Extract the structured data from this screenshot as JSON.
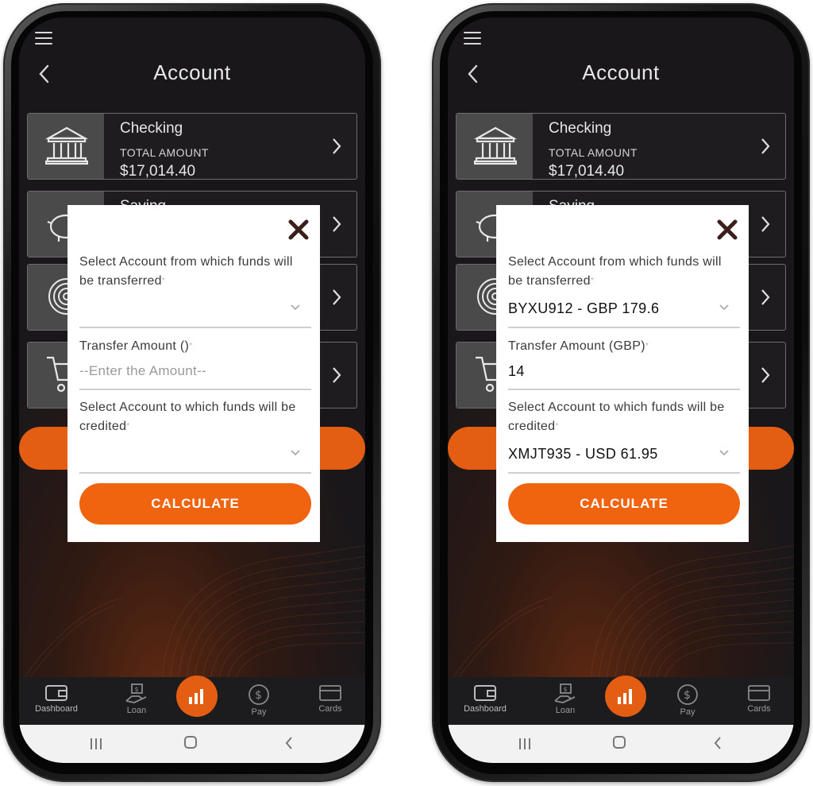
{
  "screens": [
    {
      "header": {
        "title": "Account"
      },
      "accounts": [
        {
          "name": "Checking",
          "sub": "TOTAL AMOUNT",
          "amount": "$17,014.40",
          "icon": "bank-icon"
        },
        {
          "name": "Saving",
          "icon": "piggy-bank-icon"
        },
        {
          "name": "",
          "icon": "target-icon"
        },
        {
          "name": "",
          "icon": "cart-icon"
        }
      ],
      "modal": {
        "from_label": "Select Account from which funds will be transferred",
        "from_value": "",
        "amount_label": "Transfer Amount ()",
        "amount_placeholder": "--Enter the Amount--",
        "amount_value": "",
        "to_label": "Select Account to which funds will be credited",
        "to_value": "",
        "calculate_label": "CALCULATE",
        "required_mark": "*"
      },
      "tabs": [
        {
          "label": "Dashboard"
        },
        {
          "label": "Loan"
        },
        {
          "label": ""
        },
        {
          "label": "Pay"
        },
        {
          "label": "Cards"
        }
      ]
    },
    {
      "header": {
        "title": "Account"
      },
      "accounts": [
        {
          "name": "Checking",
          "sub": "TOTAL AMOUNT",
          "amount": "$17,014.40",
          "icon": "bank-icon"
        },
        {
          "name": "Saving",
          "icon": "piggy-bank-icon"
        },
        {
          "name": "",
          "icon": "target-icon"
        },
        {
          "name": "",
          "icon": "cart-icon"
        }
      ],
      "modal": {
        "from_label": "Select Account from which funds will be transferred",
        "from_value": "BYXU912 - GBP 179.6",
        "amount_label": "Transfer Amount (GBP)",
        "amount_placeholder": "",
        "amount_value": "14",
        "to_label": "Select Account to which funds will be credited",
        "to_value": "XMJT935 - USD 61.95",
        "calculate_label": "CALCULATE",
        "required_mark": "*"
      },
      "tabs": [
        {
          "label": "Dashboard"
        },
        {
          "label": "Loan"
        },
        {
          "label": ""
        },
        {
          "label": "Pay"
        },
        {
          "label": "Cards"
        }
      ]
    }
  ],
  "colors": {
    "accent": "#f0640f",
    "screen_bg": "#19171a",
    "card_tile": "#4a4a4a"
  }
}
